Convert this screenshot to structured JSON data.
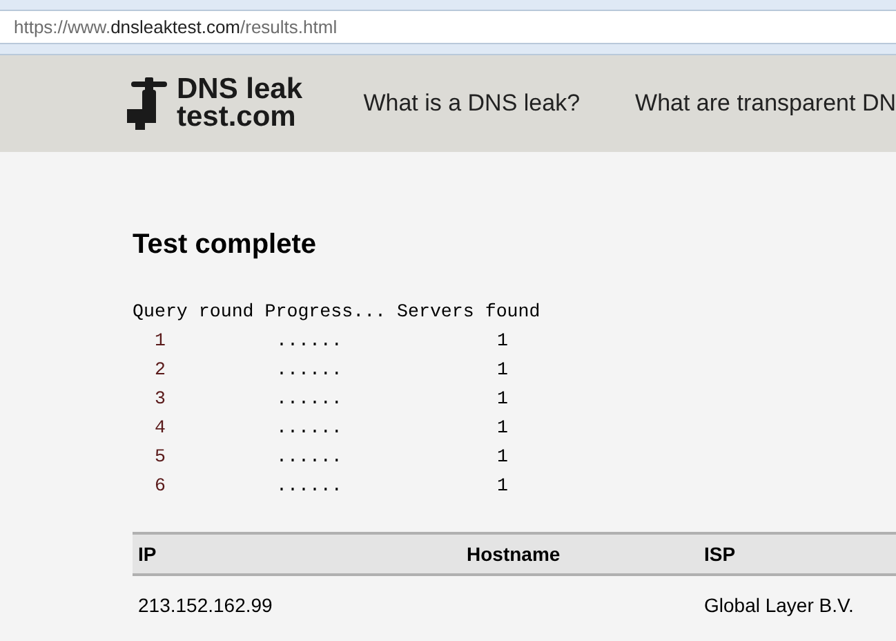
{
  "address_bar": {
    "prefix": "https://www.",
    "domain": "dnsleaktest.com",
    "path": "/results.html"
  },
  "header": {
    "logo_lines": [
      "DNS leak",
      "test.com"
    ],
    "nav": [
      "What is a DNS leak?",
      "What are transparent DN"
    ]
  },
  "title": "Test complete",
  "progress": {
    "header": "Query round Progress... Servers found",
    "rows": [
      {
        "round": "1",
        "progress": "......",
        "servers": "1"
      },
      {
        "round": "2",
        "progress": "......",
        "servers": "1"
      },
      {
        "round": "3",
        "progress": "......",
        "servers": "1"
      },
      {
        "round": "4",
        "progress": "......",
        "servers": "1"
      },
      {
        "round": "5",
        "progress": "......",
        "servers": "1"
      },
      {
        "round": "6",
        "progress": "......",
        "servers": "1"
      }
    ]
  },
  "table": {
    "columns": [
      "IP",
      "Hostname",
      "ISP"
    ],
    "rows": [
      [
        "213.152.162.99",
        "",
        "Global Layer B.V."
      ]
    ]
  }
}
